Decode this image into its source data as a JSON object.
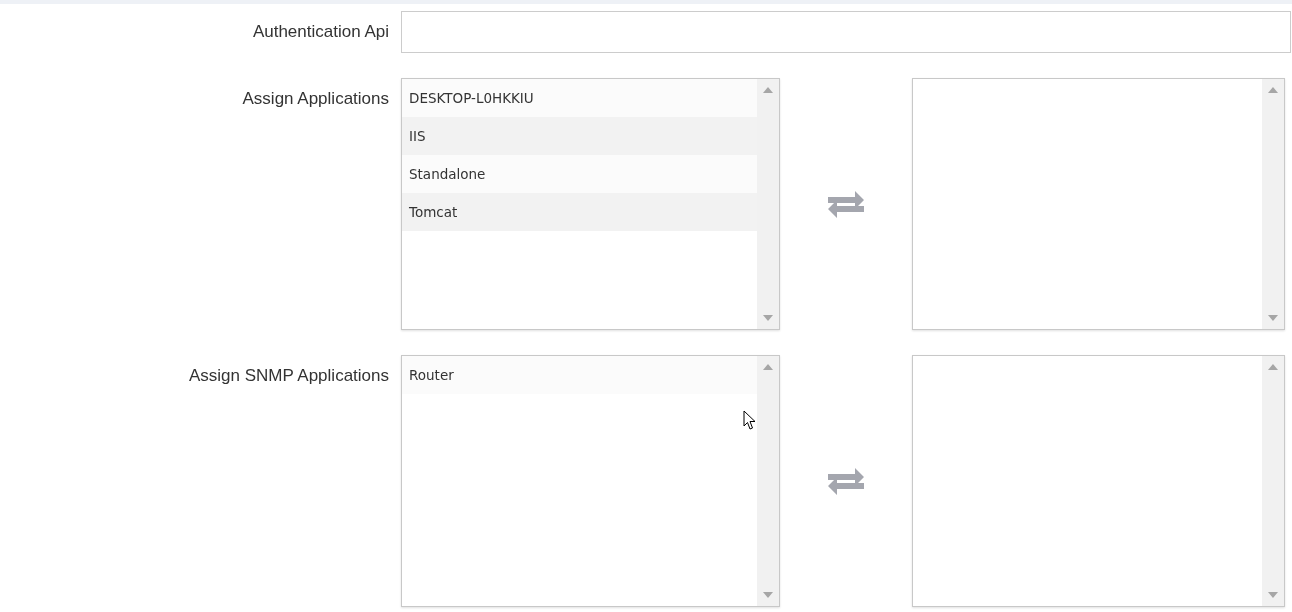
{
  "authentication_api": {
    "label": "Authentication Api"
  },
  "assign_groups": [
    {
      "label": "Assign Applications",
      "available": [
        "DESKTOP-L0HKKIU",
        "IIS",
        "Standalone",
        "Tomcat"
      ]
    },
    {
      "label": "Assign SNMP Applications",
      "available": [
        "Router"
      ]
    }
  ]
}
